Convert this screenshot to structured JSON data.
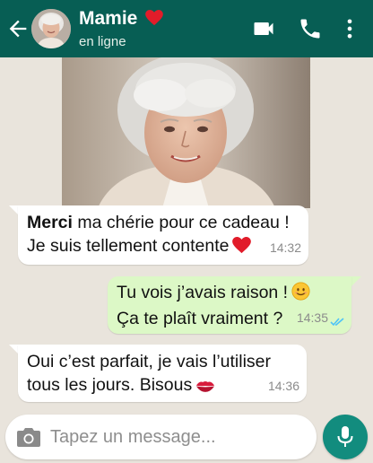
{
  "header": {
    "contact_name": "Mamie",
    "name_emoji": "red-heart",
    "status": "en ligne",
    "icons": [
      "back-arrow-icon",
      "video-call-icon",
      "phone-icon",
      "more-vertical-icon"
    ],
    "color": "#075e54"
  },
  "photo": {
    "subject": "grandmother-photo"
  },
  "messages": [
    {
      "direction": "incoming",
      "bold": "Merci",
      "line1_rest": " ma chérie pour ce cadeau !",
      "line2": "Je suis tellement contente",
      "emoji": "red-heart",
      "time": "14:32"
    },
    {
      "direction": "outgoing",
      "line1": "Tu vois j’avais raison !",
      "emoji": "smiling-face",
      "line2": "Ça te plaît vraiment ?",
      "time": "14:35",
      "status_icon": "double-check-read-icon",
      "color": "#dcf8c6"
    },
    {
      "direction": "incoming",
      "line1": "Oui c’est parfait, je vais l’utiliser",
      "line2": "tous les jours. Bisous",
      "emoji": "kiss-mark",
      "time": "14:36"
    }
  ],
  "composer": {
    "placeholder": "Tapez un message...",
    "value": "",
    "icons": [
      "camera-icon",
      "microphone-icon"
    ],
    "accent": "#128c7e"
  }
}
